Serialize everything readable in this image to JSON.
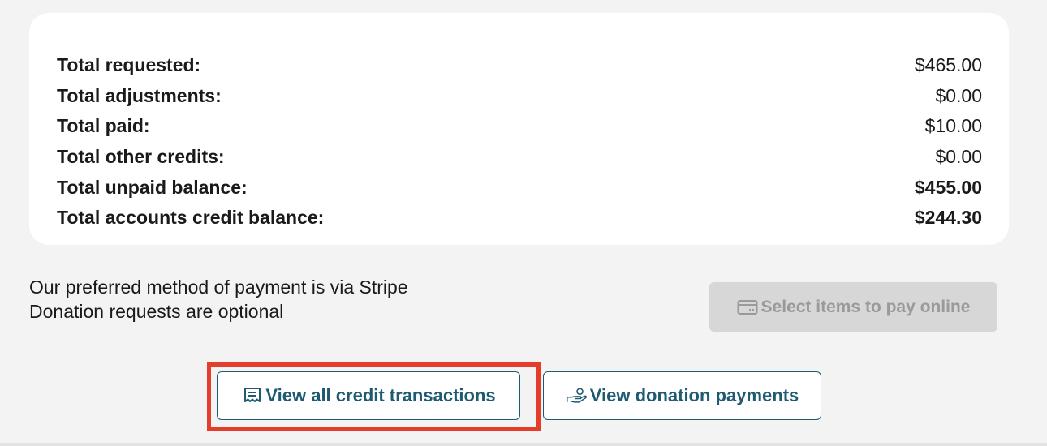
{
  "summary": {
    "rows": [
      {
        "label": "Total requested:",
        "value": "$465.00"
      },
      {
        "label": "Total adjustments:",
        "value": "$0.00"
      },
      {
        "label": "Total paid:",
        "value": "$10.00"
      },
      {
        "label": "Total other credits:",
        "value": "$0.00"
      },
      {
        "label": "Total unpaid balance:",
        "value": "$455.00"
      },
      {
        "label": "Total accounts credit balance:",
        "value": "$244.30"
      }
    ]
  },
  "info": {
    "line1": "Our preferred method of payment is via Stripe",
    "line2": "Donation requests are optional"
  },
  "buttons": {
    "pay_online": {
      "label": "Select items to pay online",
      "icon": "credit-card-icon",
      "disabled": true
    },
    "credit_transactions": {
      "label": "View all credit transactions",
      "icon": "receipt-icon"
    },
    "donation_payments": {
      "label": "View donation payments",
      "icon": "hand-coin-icon"
    }
  },
  "colors": {
    "accent": "#1e5b73",
    "highlight": "#e53d2c",
    "disabled_bg": "#d7d7d7",
    "disabled_text": "#9a9a9a"
  }
}
